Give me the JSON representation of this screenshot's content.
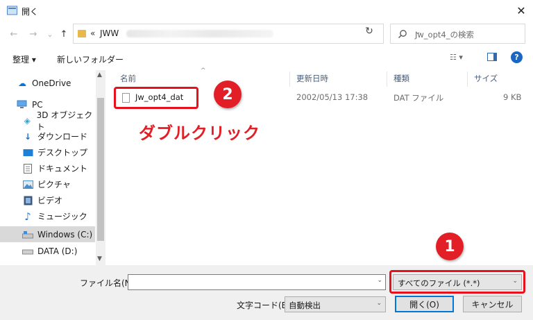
{
  "window": {
    "title": "開く",
    "close_glyph": "✕"
  },
  "nav": {
    "back_glyph": "←",
    "forward_glyph": "→",
    "dropdown_glyph": "⌄",
    "up_glyph": "↑",
    "address": {
      "separator": "«",
      "segment": "JWW",
      "dropdown_glyph": "⌄",
      "refresh_glyph": "↻"
    },
    "search_placeholder": "Jw_opt4_の検索"
  },
  "toolbar": {
    "organize": "整理 ▾",
    "new_folder": "新しいフォルダー",
    "view_glyph": "☷ ▾",
    "help": "?"
  },
  "sidebar": {
    "items": [
      {
        "label": "OneDrive",
        "icon": "cloud-icon",
        "glyph": "☁",
        "color": "#0a72d6"
      },
      {
        "label": "PC",
        "icon": "pc-icon",
        "glyph": "🖥",
        "color": "#3a7ec6"
      },
      {
        "label": "3D オブジェクト",
        "icon": "cube-icon",
        "glyph": "◈",
        "color": "#2aa6d6"
      },
      {
        "label": "ダウンロード",
        "icon": "download-icon",
        "glyph": "↓",
        "color": "#1f6fc1"
      },
      {
        "label": "デスクトップ",
        "icon": "desktop-icon",
        "glyph": "▬",
        "color": "#1d7fd6"
      },
      {
        "label": "ドキュメント",
        "icon": "document-icon",
        "glyph": "▤",
        "color": "#6e6e6e"
      },
      {
        "label": "ピクチャ",
        "icon": "picture-icon",
        "glyph": "▣",
        "color": "#4a8fc9"
      },
      {
        "label": "ビデオ",
        "icon": "video-icon",
        "glyph": "▦",
        "color": "#3b5a80"
      },
      {
        "label": "ミュージック",
        "icon": "music-icon",
        "glyph": "♪",
        "color": "#2c7fd4"
      },
      {
        "label": "Windows (C:)",
        "icon": "drive-c-icon",
        "glyph": "▭",
        "color": "#5a8fc7"
      },
      {
        "label": "DATA (D:)",
        "icon": "drive-d-icon",
        "glyph": "▭",
        "color": "#777777"
      }
    ],
    "scroll_up_glyph": "▲",
    "scroll_down_glyph": "▼"
  },
  "list": {
    "columns": {
      "name": "名前",
      "modified": "更新日時",
      "type": "種類",
      "size": "サイズ"
    },
    "sort_glyph": "^",
    "rows": [
      {
        "name": "Jw_opt4_dat",
        "modified": "2002/05/13 17:38",
        "type": "DAT ファイル",
        "size": "9 KB"
      }
    ]
  },
  "annotations": {
    "badge1": "1",
    "badge2": "2",
    "double_click": "ダブルクリック",
    "color": "#e21e26"
  },
  "footer": {
    "filename_label": "ファイル名(N):",
    "filename_value": "",
    "filter_value": "すべてのファイル  (*.*)",
    "encoding_label": "文字コード(E):",
    "encoding_value": "自動検出",
    "open_button": "開く(O)",
    "cancel_button": "キャンセル",
    "dropdown_glyph": "⌄"
  }
}
